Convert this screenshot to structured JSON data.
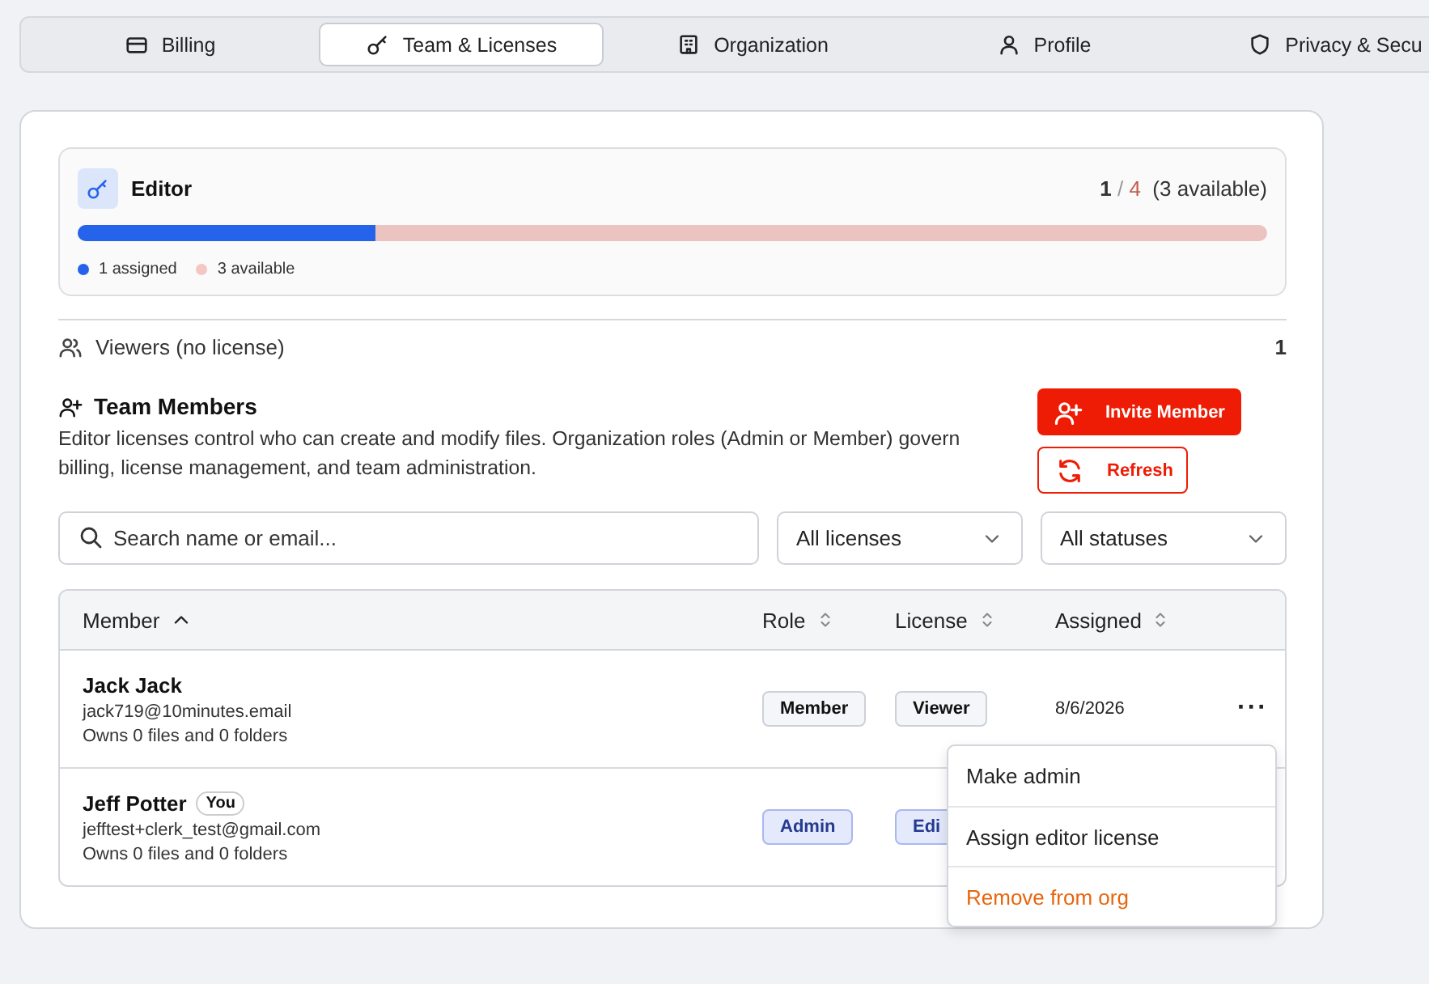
{
  "tabs": [
    {
      "label": "Billing",
      "selected": false
    },
    {
      "label": "Team & Licenses",
      "selected": true
    },
    {
      "label": "Organization",
      "selected": false
    },
    {
      "label": "Profile",
      "selected": false
    },
    {
      "label": "Privacy & Secu",
      "selected": false
    }
  ],
  "license": {
    "name": "Editor",
    "used": "1",
    "sep": "/",
    "total": "4",
    "available": "(3 available)",
    "level": 0.25,
    "legend": [
      {
        "label": "1 assigned",
        "color": "#2563eb"
      },
      {
        "label": "3 available",
        "color": "#f4c7c3"
      }
    ]
  },
  "viewers": {
    "label": "Viewers (no license)",
    "count": "1"
  },
  "team": {
    "title": "Team Members",
    "description": "Editor licenses control who can create and modify files. Organization roles (Admin or Member) govern billing, license management, and team administration.",
    "invite": "Invite Member",
    "refresh": "Refresh"
  },
  "filters": {
    "search_placeholder": "Search name or email...",
    "license": "All licenses",
    "status": "All statuses"
  },
  "table": {
    "columns": [
      "Member",
      "Role",
      "License",
      "Assigned"
    ],
    "rows": [
      {
        "name": "Jack Jack",
        "email": "jack719@10minutes.email",
        "owns": "Owns 0 files and 0 folders",
        "role": {
          "label": "Member",
          "kind": "plain"
        },
        "license": {
          "label": "Viewer",
          "kind": "plain"
        },
        "assigned": "8/6/2026",
        "more": "···"
      },
      {
        "name": "Jeff Potter",
        "you": "You",
        "email": "jefftest+clerk_test@gmail.com",
        "owns": "Owns 0 files and 0 folders",
        "role": {
          "label": "Admin",
          "kind": "accent"
        },
        "license": {
          "label": "Edi",
          "kind": "accent"
        }
      }
    ]
  },
  "menu": [
    {
      "label": "Make admin",
      "kind": "normal"
    },
    {
      "label": "Assign editor license",
      "kind": "normal"
    },
    {
      "label": "Remove from org",
      "kind": "danger"
    }
  ]
}
